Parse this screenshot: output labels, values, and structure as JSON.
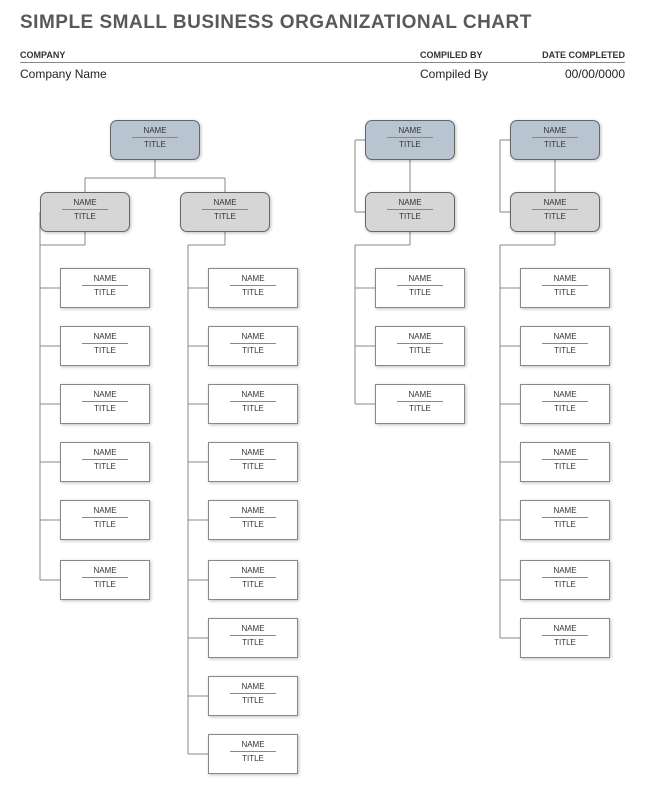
{
  "title": "SIMPLE SMALL BUSINESS ORGANIZATIONAL CHART",
  "header": {
    "company_label": "COMPANY",
    "compiled_label": "COMPILED BY",
    "date_label": "DATE COMPLETED",
    "company_value": "Company Name",
    "compiled_value": "Compiled By",
    "date_value": "00/00/0000"
  },
  "node_text": {
    "name": "NAME",
    "title": "TITLE"
  },
  "org_structure": {
    "branches": [
      {
        "top": {
          "name": "NAME",
          "title": "TITLE"
        },
        "mids": [
          {
            "name": "NAME",
            "title": "TITLE",
            "leaves": [
              {
                "name": "NAME",
                "title": "TITLE"
              },
              {
                "name": "NAME",
                "title": "TITLE"
              },
              {
                "name": "NAME",
                "title": "TITLE"
              },
              {
                "name": "NAME",
                "title": "TITLE"
              },
              {
                "name": "NAME",
                "title": "TITLE"
              },
              {
                "name": "NAME",
                "title": "TITLE"
              }
            ]
          },
          {
            "name": "NAME",
            "title": "TITLE",
            "leaves": [
              {
                "name": "NAME",
                "title": "TITLE"
              },
              {
                "name": "NAME",
                "title": "TITLE"
              },
              {
                "name": "NAME",
                "title": "TITLE"
              },
              {
                "name": "NAME",
                "title": "TITLE"
              },
              {
                "name": "NAME",
                "title": "TITLE"
              },
              {
                "name": "NAME",
                "title": "TITLE"
              },
              {
                "name": "NAME",
                "title": "TITLE"
              },
              {
                "name": "NAME",
                "title": "TITLE"
              },
              {
                "name": "NAME",
                "title": "TITLE"
              }
            ]
          }
        ]
      },
      {
        "top": {
          "name": "NAME",
          "title": "TITLE"
        },
        "mids": [
          {
            "name": "NAME",
            "title": "TITLE",
            "leaves": [
              {
                "name": "NAME",
                "title": "TITLE"
              },
              {
                "name": "NAME",
                "title": "TITLE"
              },
              {
                "name": "NAME",
                "title": "TITLE"
              }
            ]
          }
        ]
      },
      {
        "top": {
          "name": "NAME",
          "title": "TITLE"
        },
        "mids": [
          {
            "name": "NAME",
            "title": "TITLE",
            "leaves": [
              {
                "name": "NAME",
                "title": "TITLE"
              },
              {
                "name": "NAME",
                "title": "TITLE"
              },
              {
                "name": "NAME",
                "title": "TITLE"
              },
              {
                "name": "NAME",
                "title": "TITLE"
              },
              {
                "name": "NAME",
                "title": "TITLE"
              },
              {
                "name": "NAME",
                "title": "TITLE"
              },
              {
                "name": "NAME",
                "title": "TITLE"
              }
            ]
          }
        ]
      }
    ]
  }
}
